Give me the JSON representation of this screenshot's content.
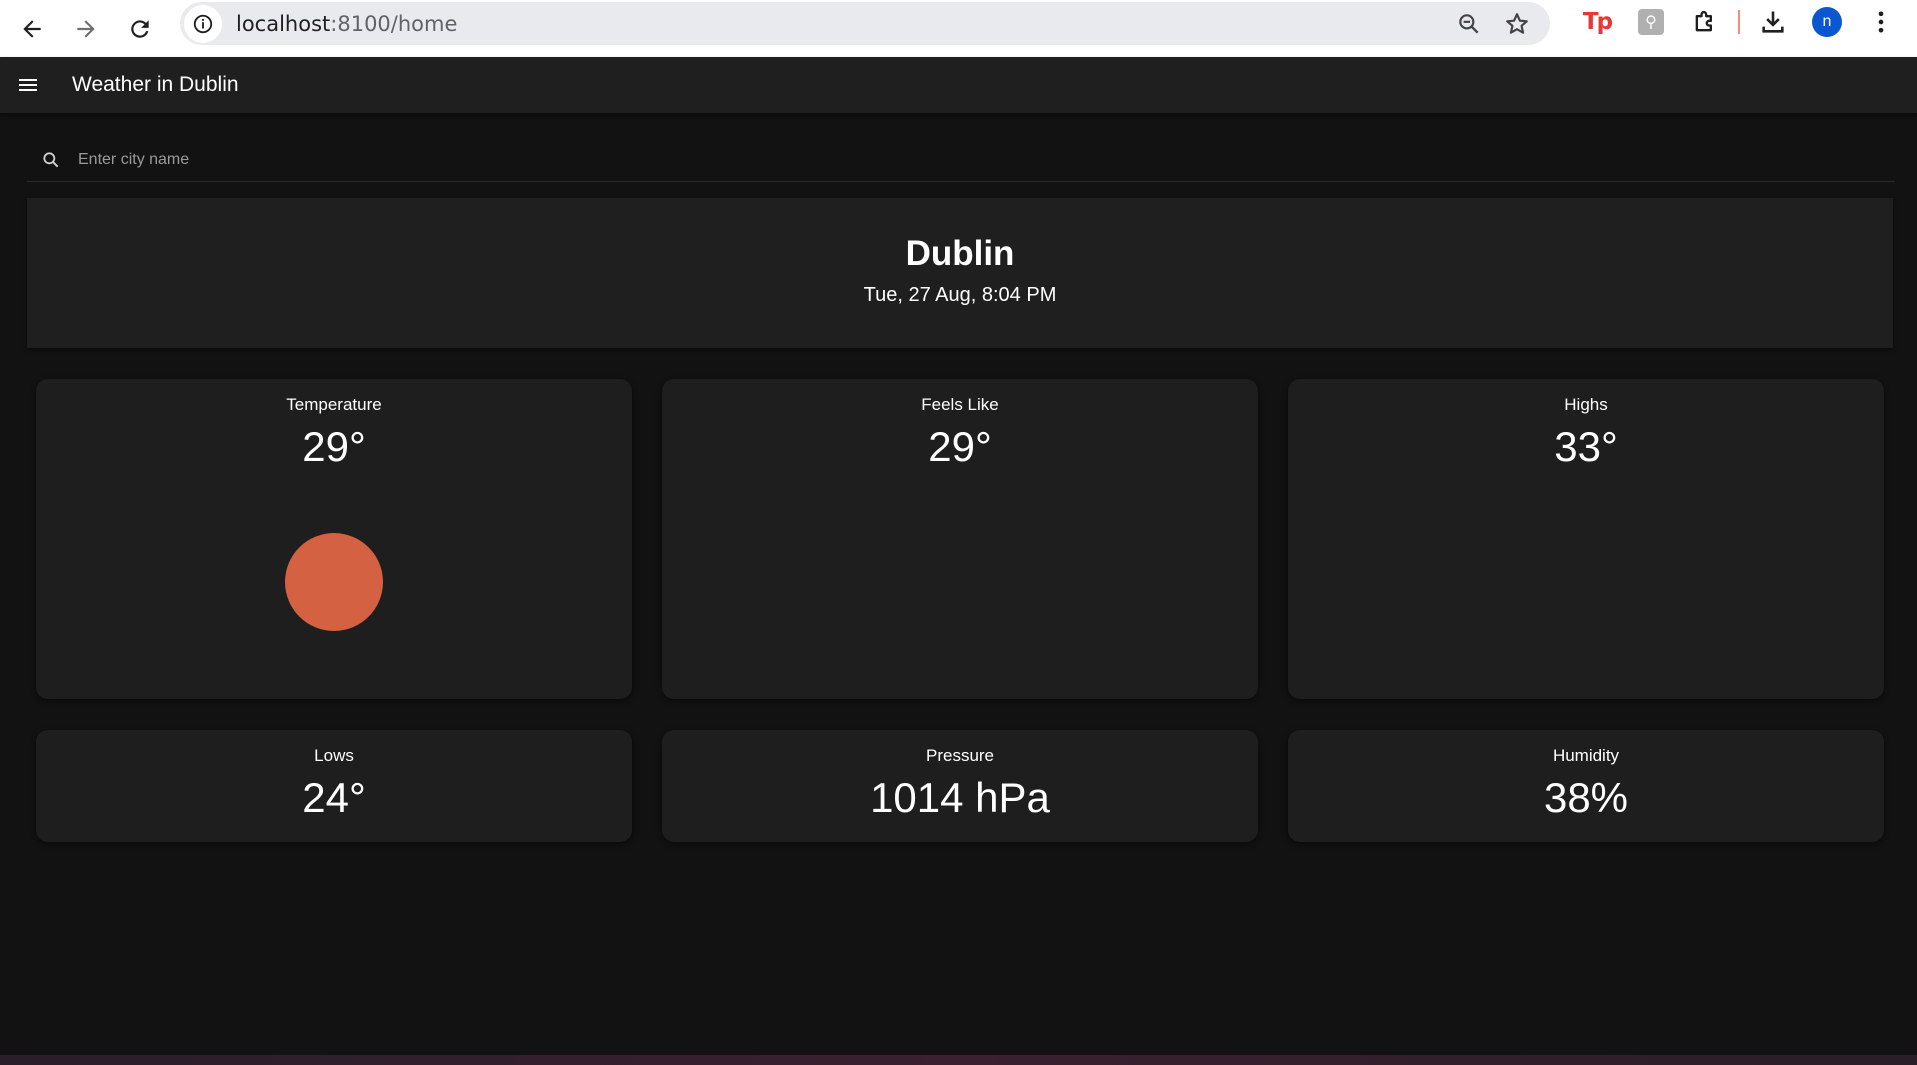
{
  "browser": {
    "url_host": "localhost",
    "url_path": ":8100/home",
    "profile_initial": "n",
    "extension_tp": "Tp"
  },
  "toolbar": {
    "title": "Weather in Dublin"
  },
  "search": {
    "placeholder": "Enter city name",
    "value": ""
  },
  "location": {
    "city": "Dublin",
    "datetime": "Tue, 27 Aug, 8:04 PM"
  },
  "stats": {
    "temperature": {
      "label": "Temperature",
      "value": "29°"
    },
    "feels_like": {
      "label": "Feels Like",
      "value": "29°"
    },
    "highs": {
      "label": "Highs",
      "value": "33°"
    },
    "lows": {
      "label": "Lows",
      "value": "24°"
    },
    "pressure": {
      "label": "Pressure",
      "value": "1014 hPa"
    },
    "humidity": {
      "label": "Humidity",
      "value": "38%"
    }
  },
  "colors": {
    "background": "#121212",
    "card": "#1e1e1e",
    "sun": "#d46142"
  },
  "icons": {
    "back": "arrow-left-icon",
    "forward": "arrow-right-icon",
    "reload": "reload-icon",
    "site_info": "info-icon",
    "zoom": "zoom-icon",
    "bookmark": "star-icon",
    "extensions": "puzzle-icon",
    "download": "download-icon",
    "more": "more-vert-icon",
    "menu": "menu-icon",
    "search": "search-icon"
  }
}
